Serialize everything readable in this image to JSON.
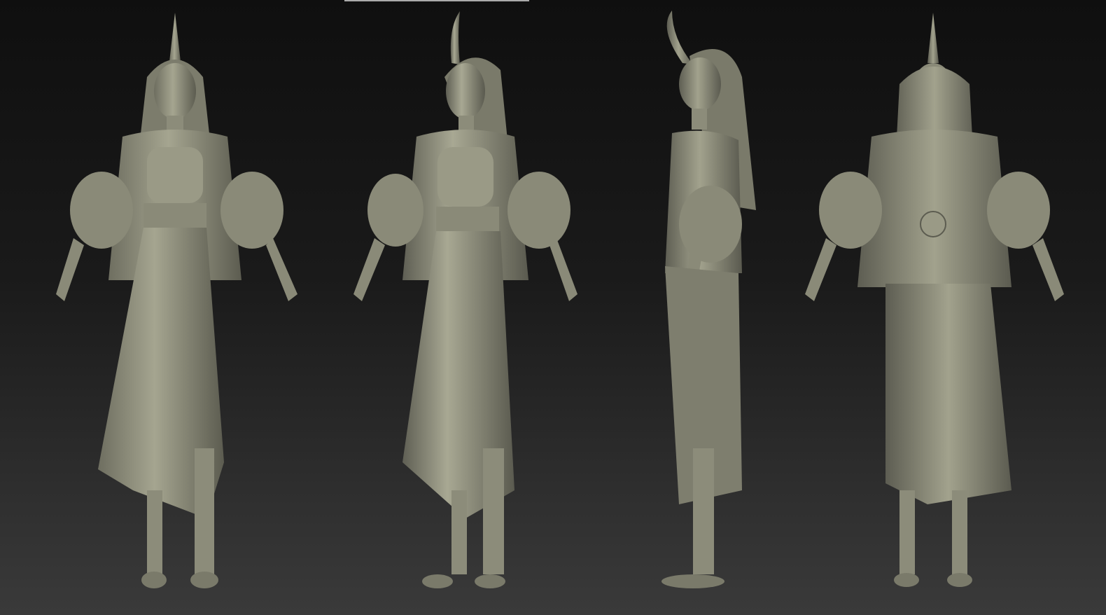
{
  "scene": {
    "views": [
      {
        "id": "front"
      },
      {
        "id": "three-quarter"
      },
      {
        "id": "side"
      },
      {
        "id": "back"
      }
    ],
    "colors": {
      "clay": "#8f8f7d",
      "clay_light": "#a5a58f",
      "clay_dark": "#606052",
      "background_top": "#0f0f0f",
      "background_bottom": "#3a3a3a"
    }
  }
}
